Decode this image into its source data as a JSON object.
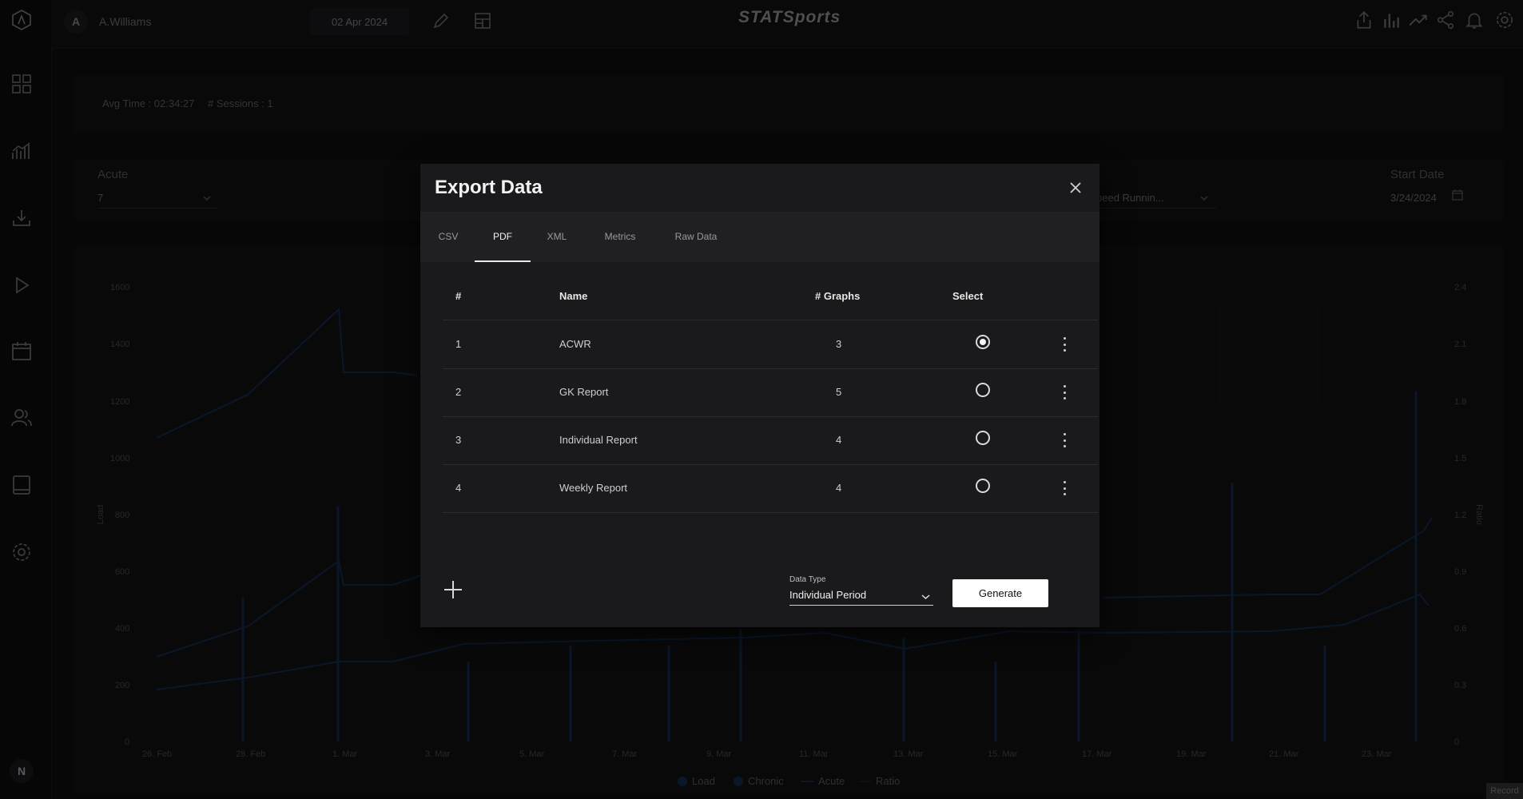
{
  "topbar": {
    "avatar_letter": "A",
    "user_name": "A.Williams",
    "date": "02 Apr 2024",
    "brand": "STATSports"
  },
  "sidebar": {
    "bottom_avatar": "N",
    "icons": [
      "logo-icon",
      "dashboard-icon",
      "analytics-icon",
      "download-icon",
      "play-icon",
      "calendar-icon",
      "team-icon",
      "tablet-icon",
      "settings-icon"
    ]
  },
  "summary": {
    "avg_time": "Avg Time : 02:34:27",
    "sessions": "# Sessions : 1"
  },
  "filters": {
    "acute_label": "Acute",
    "acute_value": "7",
    "metric_value_partial": "peed Runnin...",
    "start_date_label": "Start Date",
    "start_date_value": "3/24/2024"
  },
  "background_chart": {
    "y_left_label": "Load",
    "y_right_label": "Ratio",
    "y_left_ticks": [
      "1600",
      "1400",
      "1200",
      "1000",
      "800",
      "600",
      "400",
      "200",
      "0"
    ],
    "y_right_ticks": [
      "2.4",
      "2.1",
      "1.8",
      "1.5",
      "1.2",
      "0.9",
      "0.6",
      "0.3",
      "0"
    ],
    "x_ticks": [
      "26. Feb",
      "28. Feb",
      "1. Mar",
      "3. Mar",
      "5. Mar",
      "7. Mar",
      "9. Mar",
      "11. Mar",
      "13. Mar",
      "15. Mar",
      "17. Mar",
      "19. Mar",
      "21. Mar",
      "23. Mar"
    ],
    "legend": [
      "Load",
      "Chronic",
      "Acute",
      "Ratio"
    ],
    "record_label": "Record"
  },
  "modal": {
    "title": "Export Data",
    "tabs": [
      {
        "label": "CSV",
        "active": false
      },
      {
        "label": "PDF",
        "active": true
      },
      {
        "label": "XML",
        "active": false
      },
      {
        "label": "Metrics",
        "active": false
      },
      {
        "label": "Raw Data",
        "active": false
      }
    ],
    "columns": {
      "num": "#",
      "name": "Name",
      "graphs": "# Graphs",
      "select": "Select"
    },
    "rows": [
      {
        "num": "1",
        "name": "ACWR",
        "graphs": "3",
        "selected": true
      },
      {
        "num": "2",
        "name": "GK Report",
        "graphs": "5",
        "selected": false
      },
      {
        "num": "3",
        "name": "Individual Report",
        "graphs": "4",
        "selected": false
      },
      {
        "num": "4",
        "name": "Weekly Report",
        "graphs": "4",
        "selected": false
      }
    ],
    "data_type_label": "Data Type",
    "data_type_value": "Individual Period",
    "generate_label": "Generate"
  }
}
